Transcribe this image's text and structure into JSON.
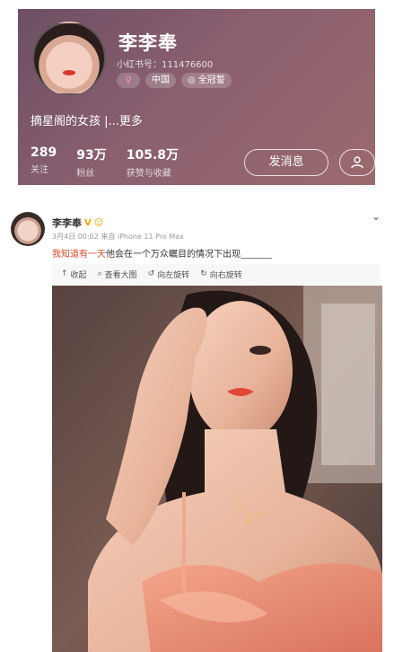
{
  "profile": {
    "name": "李李奉",
    "red_id": "小红书号：111476600",
    "gender_symbol": "♀",
    "location": "中国",
    "badge": "全冠誓",
    "bio": "摘星阁的女孩 |...更多",
    "stats": [
      {
        "value": "289",
        "label": "关注"
      },
      {
        "value": "93万",
        "label": "粉丝"
      },
      {
        "value": "105.8万",
        "label": "获赞与收藏"
      }
    ],
    "message_button": "发消息"
  },
  "post": {
    "author": "李李奉",
    "meta": "3月4日 00:02 来自 iPhone 11 Pro Max",
    "text_highlight": "我知道有一天",
    "text_rest": "他会在一个万众瞩目的情况下出现_______",
    "actions": {
      "collapse": "收起",
      "view_large": "查看大图",
      "rotate_left": "向左旋转",
      "rotate_right": "向右旋转"
    }
  },
  "colors": {
    "profile_bg": "#7b5567",
    "highlight": "#d24a2c"
  }
}
